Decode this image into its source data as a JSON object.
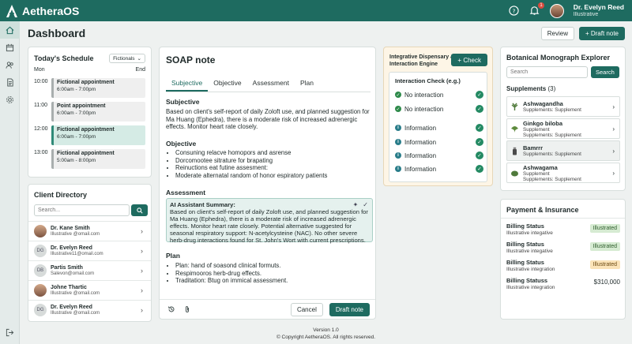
{
  "app": {
    "name": "AetheraOS"
  },
  "topbar": {
    "notif_count": "1",
    "user_name": "Dr. Evelyn Reed",
    "user_role": "Illustrative"
  },
  "header": {
    "title": "Dashboard",
    "review_label": "Review",
    "draft_label": "+ Draft note"
  },
  "schedule": {
    "title": "Today's Schedule",
    "filter": "Fictionals",
    "mon": "Mon",
    "end": "End",
    "times": [
      "10:00",
      "11:00",
      "12:00",
      "13:00"
    ],
    "appointments": [
      {
        "title": "Fictional appointment",
        "time": "6:00am - 7:00pm"
      },
      {
        "title": "Point appointment",
        "time": "6:00am - 7:00pm"
      },
      {
        "title": "Fictional appointment",
        "time": "6:00am - 7:00pm"
      },
      {
        "title": "Fictional appointment",
        "time": "5:00am - 8:00pm"
      }
    ]
  },
  "clients": {
    "title": "Client Directory",
    "search_placeholder": "Search...",
    "items": [
      {
        "initials": "",
        "name": "Dr. Kane Smith",
        "email": "Illustrative @omail.com"
      },
      {
        "initials": "DG",
        "name": "Dr. Evelyn Reed",
        "email": "Illustrative11@omail.com"
      },
      {
        "initials": "DB",
        "name": "Partis Smith",
        "email": "Salevon@omail.com"
      },
      {
        "initials": "",
        "name": "Johne Thartic",
        "email": "Illustrative @omail.com"
      },
      {
        "initials": "DG",
        "name": "Dr. Evelyn Reed",
        "email": "Illustrative @omail.com"
      }
    ]
  },
  "soap": {
    "title": "SOAP note",
    "tabs": [
      "Subjective",
      "Objective",
      "Assessment",
      "Plan"
    ],
    "subjective_h": "Subjective",
    "subjective_text": "Based on client's self-report of daily Zoloft use, and planned suggestion for Ma Huang (Ephedra), there is a moderate risk of increased adrenergic effects. Monitor heart rate closely.",
    "objective_h": "Objective",
    "objective_items": [
      "Consuning relacve homopors and asrense",
      "Dorcomootee sitrature for brapating",
      "Reinuctions eat futine assesment:",
      "Moderate alternatal random of honor espiratory patients"
    ],
    "assessment_h": "Assessment",
    "ai_title": "AI Assistant Summary:",
    "ai_text": "Based on client's self-report of daily Zoloft use, and planned suggestion for Ma Huang (Ephedra), there is a moderate risk of increased adrenergic effects. Monitor heart rate closely. Potential alternative suggested for seasonal respiratory support: N-acetylcysteine (NAC). No other severe herb-drug interactions found for St. John's Wort with current prescriptions.",
    "plan_h": "Plan",
    "plan_items": [
      "Plan: hand of soasond clinical formuts.",
      "Respimooros herb-drug effects.",
      "Traditation: Btug on immical assessment."
    ],
    "cancel_label": "Cancel",
    "draft_label": "Draft note"
  },
  "interaction": {
    "title": "Integrative Dispensary & Interaction Engine",
    "check_label": "+ Check",
    "inner_title": "Interaction Check (e.g.)",
    "rows": [
      {
        "label": "No interaction",
        "kind": "green"
      },
      {
        "label": "No interaction",
        "kind": "green"
      },
      {
        "label": "Information",
        "kind": "info"
      },
      {
        "label": "Information",
        "kind": "info"
      },
      {
        "label": "Information",
        "kind": "info"
      },
      {
        "label": "Information",
        "kind": "info"
      }
    ]
  },
  "botanical": {
    "title": "Botanical Monograph Explorer",
    "search_placeholder": "Search",
    "search_label": "Search",
    "supplements_label": "Supplements",
    "supplements_count": "(3)",
    "items": [
      {
        "name": "Ashwagandha",
        "sub1": "Supplements: Supplement",
        "sub2": ""
      },
      {
        "name": "Ginkgo biloba",
        "sub1": "Supplement",
        "sub2": "Supplements: Supplement"
      },
      {
        "name": "Bamrrr",
        "sub1": "Supplements: Supplement",
        "sub2": ""
      },
      {
        "name": "Ashwagama",
        "sub1": "Supplement",
        "sub2": "Supplements: Supplement"
      }
    ]
  },
  "payment": {
    "title": "Payment & Insurance",
    "rows": [
      {
        "label": "Billing Status",
        "sub": "Illustrative integative",
        "value": "Illustrated",
        "kind": "green"
      },
      {
        "label": "Billing Status",
        "sub": "Illustrative integative",
        "value": "Illustrated",
        "kind": "green"
      },
      {
        "label": "Billing Status",
        "sub": "Illustrative integration",
        "value": "Illustrated",
        "kind": "amber"
      },
      {
        "label": "Billing Statuss",
        "sub": "Illustrative integration",
        "value": "$310,000",
        "kind": "amount"
      }
    ]
  },
  "footer": {
    "version": "Version 1.0",
    "copyright": "© Copyright AetheraOS. All rights reserved."
  }
}
